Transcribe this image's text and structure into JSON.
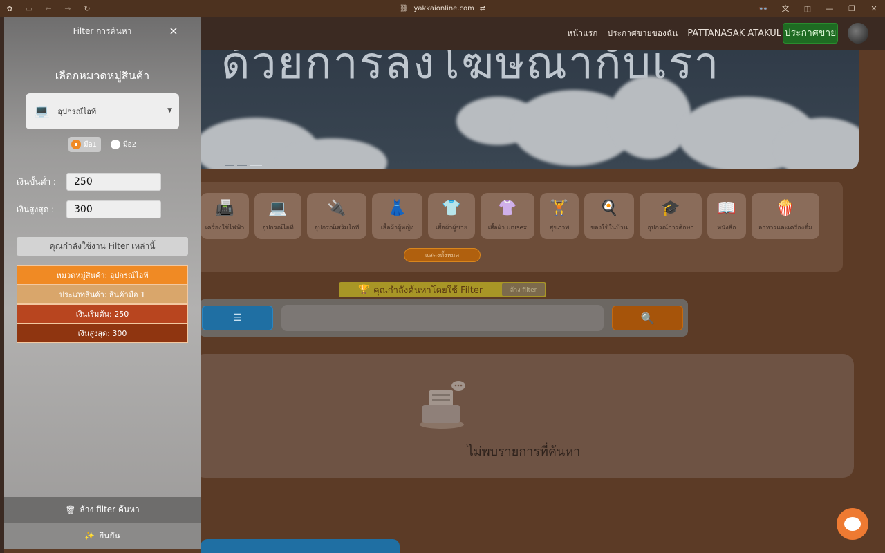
{
  "browser": {
    "url": "yakkaionline.com"
  },
  "nav": {
    "home": "หน้าแรก",
    "my_ads": "ประกาศขายของฉัน",
    "user": "PATTANASAK ATAKUL",
    "sell_button": "ประกาศขาย"
  },
  "hero": {
    "text": "ด้วยการลงโฆษณากับเรา"
  },
  "categories": [
    {
      "label": "เครื่องใช้ไฟฟ้า",
      "icon": "📠",
      "w": 70
    },
    {
      "label": "อุปกรณ์ไอที",
      "icon": "💻",
      "w": 68
    },
    {
      "label": "อุปกรณ์เสริมไอที",
      "icon": "🔌",
      "w": 86
    },
    {
      "label": "เสื้อผ้าผู้หญิง",
      "icon": "👗",
      "w": 73
    },
    {
      "label": "เสื้อผ้าผู้ชาย",
      "icon": "👕",
      "w": 68
    },
    {
      "label": "เสื้อผ้า unisex",
      "icon": "👚",
      "w": 78
    },
    {
      "label": "สุขภาพ",
      "icon": "🏋",
      "w": 56
    },
    {
      "label": "ของใช้ในบ้าน",
      "icon": "🍳",
      "w": 72
    },
    {
      "label": "อุปกรณ์การศึกษา",
      "icon": "🎓",
      "w": 90
    },
    {
      "label": "หนังสือ",
      "icon": "📖",
      "w": 56
    },
    {
      "label": "อาหารและเครื่องดื่ม",
      "icon": "🍿",
      "w": 98
    }
  ],
  "show_all": "แสดงทั้งหมด",
  "using_filter_banner": {
    "icon": "🏆",
    "text": "คุณกำลังค้นหาโดยใช้ Filter",
    "tag": "ล้าง filter"
  },
  "search": {
    "menu_icon": "☰",
    "search_icon": "🔍",
    "placeholder": ""
  },
  "results": {
    "empty_text": "ไม่พบรายการที่ค้นหา"
  },
  "filter": {
    "title": "Filter การค้นหา",
    "close": "×",
    "section_title": "เลือกหมวดหมู่สินค้า",
    "category": {
      "icon": "💻",
      "value": "อุปกรณ์ไอที",
      "caret": "▼"
    },
    "condition_options": [
      {
        "label": "มือ1",
        "selected": true
      },
      {
        "label": "มือ2",
        "selected": false
      }
    ],
    "min_label": "เงินขั้นต่ำ :",
    "min_value": "250",
    "max_label": "เงินสูงสุด :",
    "max_value": "300",
    "using_label": "คุณกำลังใช้งาน Filter เหล่านี้",
    "chips": [
      {
        "text": "หมวดหมู่สินค้า: อุปกรณ์ไอที",
        "color": "#f08a24"
      },
      {
        "text": "ประเภทสินค้า: สินค้ามือ 1",
        "color": "#d9a66b"
      },
      {
        "text": "เงินเริ่มต้น: 250",
        "color": "#b8451f"
      },
      {
        "text": "เงินสูงสุด: 300",
        "color": "#8f3510"
      }
    ],
    "clear_button": "ล้าง filter ค้นหา",
    "clear_icon": "🗑",
    "confirm_button": "ยืนยัน",
    "confirm_icon": "✨"
  }
}
